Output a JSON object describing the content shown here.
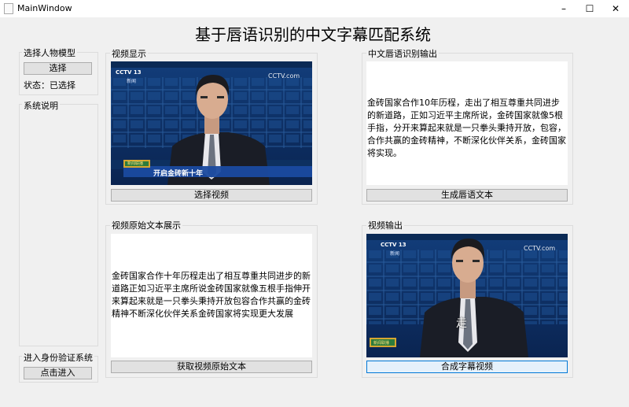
{
  "window": {
    "title": "MainWindow",
    "minimize": "–",
    "maximize": "☐",
    "close": "✕"
  },
  "app_title": "基于唇语识别的中文字幕匹配系统",
  "sidebar": {
    "model_group_label": "选择人物模型",
    "select_button": "选择",
    "status_text": "状态：已选择",
    "system_info_label": "系统说明",
    "verify_label": "进入身份验证系统",
    "enter_button": "点击进入"
  },
  "video_display": {
    "label": "视频显示",
    "button": "选择视频",
    "channel": "CCTV 13",
    "channel_sub": "新闻",
    "logo": "CCTV.com",
    "news_badge": "新闻联播",
    "caption": "开启金砖新十年"
  },
  "lip_output": {
    "label": "中文唇语识别输出",
    "text": "金砖国家合作10年历程，走出了相互尊重共同进步的新道路，正如习近平主席所说，金砖国家就像5根手指，分开来算起来就是一只拳头秉持开放，包容，合作共赢的金砖精神，不断深化伙伴关系，金砖国家将实现。",
    "button": "生成唇语文本"
  },
  "original_text": {
    "label": "视频原始文本展示",
    "text": "金砖国家合作十年历程走出了相互尊重共同进步的新道路正如习近平主席所说金砖国家就像五根手指伸开来算起来就是一只拳头秉持开放包容合作共赢的金砖精神不断深化伙伴关系金砖国家将实现更大发展",
    "button": "获取视频原始文本"
  },
  "video_output": {
    "label": "视频输出",
    "button": "合成字幕视频",
    "channel": "CCTV 13",
    "channel_sub": "新闻",
    "logo": "CCTV.com",
    "news_badge": "新闻联播",
    "subtitle": "走"
  }
}
